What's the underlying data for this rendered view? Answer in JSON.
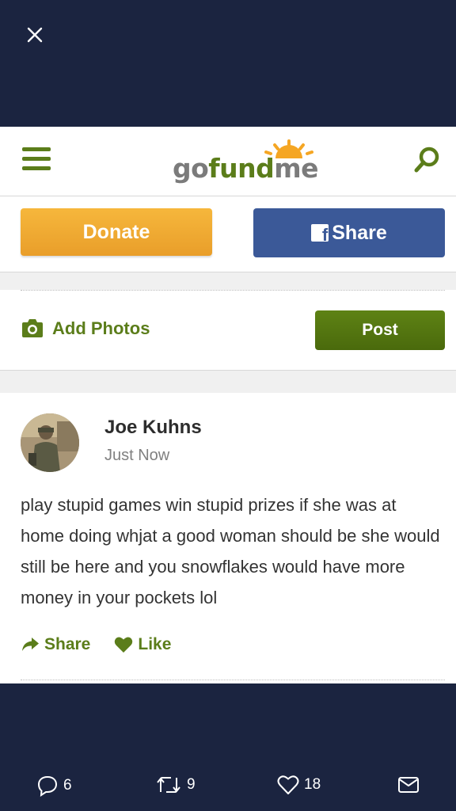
{
  "header": {
    "logo_go": "go",
    "logo_fund": "fund",
    "logo_me": "me",
    "icons": {
      "menu": "hamburger-icon",
      "search": "search-icon",
      "close": "close-icon"
    },
    "colors": {
      "brand_green": "#5b7d1a",
      "donate_orange": "#f0aa33",
      "facebook_blue": "#3b5998",
      "background_navy": "#1b2440"
    }
  },
  "actions": {
    "donate_label": "Donate",
    "share_label": "Share",
    "share_icon": "facebook-icon"
  },
  "compose": {
    "add_photos_label": "Add Photos",
    "add_photos_icon": "camera-icon",
    "post_label": "Post"
  },
  "comment": {
    "author": "Joe Kuhns",
    "timestamp": "Just Now",
    "text": "play stupid games win stupid prizes if she was at home doing whjat a good woman should be she would still be here and you snowflakes would have more money in your pockets lol",
    "share_label": "Share",
    "like_label": "Like"
  },
  "tweet_actions": {
    "replies": "6",
    "retweets": "9",
    "likes": "18"
  }
}
